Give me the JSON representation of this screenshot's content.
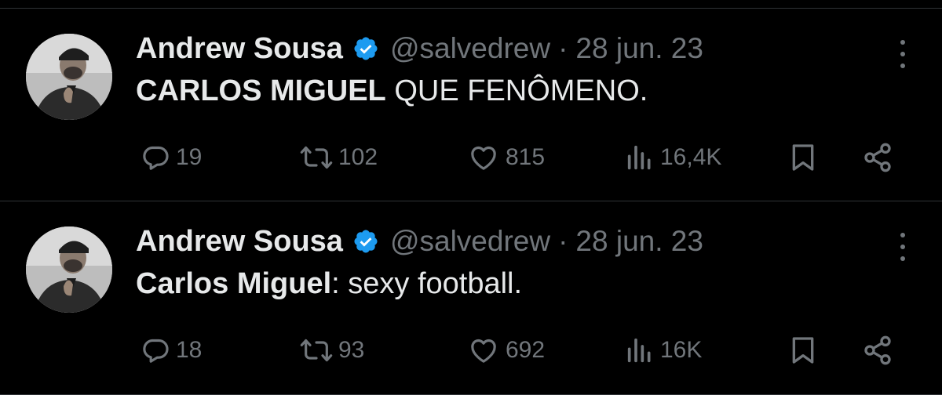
{
  "colors": {
    "background": "#000000",
    "text_primary": "#e7e9ea",
    "text_secondary": "#71767b",
    "verified_blue": "#1d9bf0",
    "divider": "#2f3336"
  },
  "tweets": [
    {
      "author": {
        "name": "Andrew Sousa",
        "handle": "@salvedrew",
        "verified_icon": "verified-badge-icon"
      },
      "separator": "·",
      "date": "28 jun. 23",
      "text": {
        "bold": "CARLOS MIGUEL",
        "rest": " QUE FENÔMENO."
      },
      "stats": {
        "replies": "19",
        "retweets": "102",
        "likes": "815",
        "views": "16,4K"
      }
    },
    {
      "author": {
        "name": "Andrew Sousa",
        "handle": "@salvedrew",
        "verified_icon": "verified-badge-icon"
      },
      "separator": "·",
      "date": "28 jun. 23",
      "text": {
        "bold": "Carlos Miguel",
        "rest": ": sexy football."
      },
      "stats": {
        "replies": "18",
        "retweets": "93",
        "likes": "692",
        "views": "16K"
      }
    }
  ]
}
